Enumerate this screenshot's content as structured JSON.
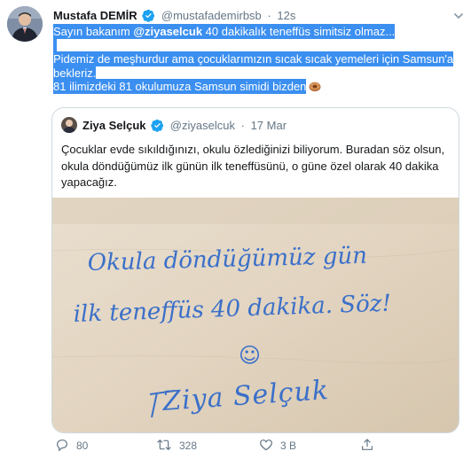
{
  "tweet": {
    "author_name": "Mustafa DEMİR",
    "author_handle": "@mustafademirbsb",
    "separator": "·",
    "time": "12s",
    "lines": [
      {
        "pre": "Sayın bakanım ",
        "mention": "@ziyaselcuk",
        "post": " 40 dakikalık teneffüs simitsiz olmaz..."
      },
      {
        "text": "Pidemiz de meşhurdur ama çocuklarımızın sıcak sıcak yemeleri için Samsun'a"
      },
      {
        "text": "bekleriz."
      },
      {
        "text": "81 ilimizdeki 81 okulumuza Samsun simidi bizden"
      }
    ]
  },
  "quote": {
    "author_name": "Ziya Selçuk",
    "author_handle": "@ziyaselcuk",
    "separator": "·",
    "date": "17 Mar",
    "text": "Çocuklar evde sıkıldığınızı, okulu özlediğinizi biliyorum. Buradan söz olsun, okula döndüğümüz ilk günün ilk teneffüsünü, o güne özel olarak 40 dakika yapacağız.",
    "note": {
      "line1": "Okula döndüğümüz gün",
      "line2": "ilk teneffüs 40 dakika. Söz!",
      "smiley": "☺",
      "signature": "Ziya Selçuk"
    }
  },
  "actions": {
    "reply_count": "80",
    "retweet_count": "328",
    "like_count": "3 B"
  },
  "colors": {
    "selection": "#3b8ff0",
    "verified": "#1da1f2",
    "secondary_text": "#657786",
    "ink": "#3a6fc9",
    "paper": "#e3d6c3"
  },
  "icons": [
    "verified-badge-icon",
    "caret-down-icon",
    "simit-emoji-icon",
    "reply-icon",
    "retweet-icon",
    "like-icon",
    "share-icon"
  ]
}
